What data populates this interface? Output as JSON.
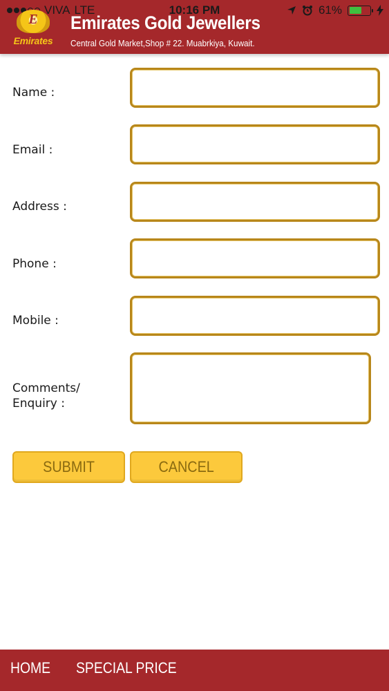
{
  "status_bar": {
    "carrier": "VIVA",
    "network": "LTE",
    "time": "10:16 PM",
    "battery_percent_label": "61%",
    "battery_level": 0.61
  },
  "header": {
    "logo_text": "Emirates",
    "logo_letter": "E",
    "title": "Emirates Gold Jewellers",
    "subtitle": "Central Gold Market,Shop # 22. Muabrkiya, Kuwait."
  },
  "form": {
    "fields": [
      {
        "label": "Name :",
        "value": ""
      },
      {
        "label": "Email :",
        "value": ""
      },
      {
        "label": "Address :",
        "value": ""
      },
      {
        "label": "Phone :",
        "value": ""
      },
      {
        "label": "Mobile :",
        "value": ""
      }
    ],
    "comments": {
      "label_line1": "Comments/",
      "label_line2": "Enquiry :",
      "value": ""
    },
    "submit_label": "SUBMIT",
    "cancel_label": "CANCEL"
  },
  "bottom_nav": {
    "items": [
      {
        "label": "HOME"
      },
      {
        "label": "SPECIAL PRICE"
      }
    ]
  },
  "colors": {
    "brand_red": "#a5282b",
    "input_border_gold": "#b8871a",
    "button_yellow": "#fcc93c",
    "button_text": "#8a6a10"
  }
}
